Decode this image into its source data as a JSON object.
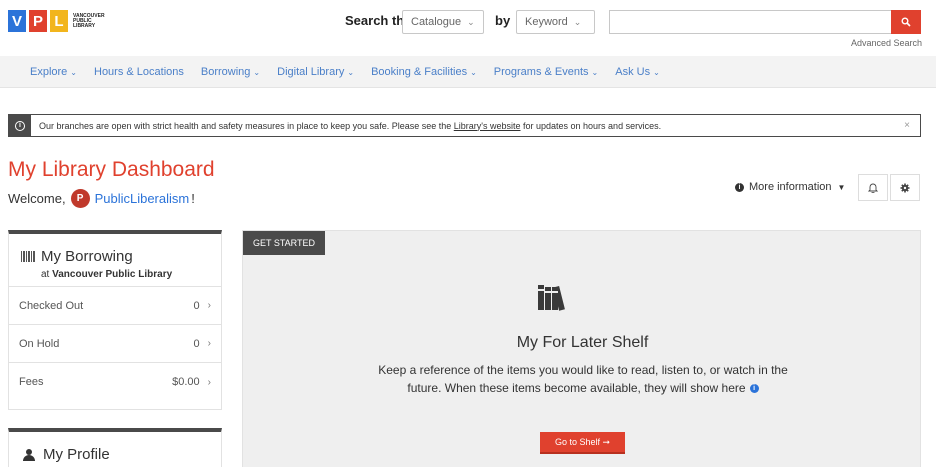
{
  "header": {
    "logo_letters": [
      "V",
      "P",
      "L"
    ],
    "logo_text": "VANCOUVER PUBLIC LIBRARY",
    "search_label": "Search the",
    "catalogue_select": "Catalogue",
    "by_label": "by",
    "keyword_select": "Keyword",
    "search_value": "",
    "advanced_search": "Advanced Search"
  },
  "nav": {
    "items": [
      {
        "label": "Explore",
        "dropdown": true
      },
      {
        "label": "Hours & Locations",
        "dropdown": false
      },
      {
        "label": "Borrowing",
        "dropdown": true
      },
      {
        "label": "Digital Library",
        "dropdown": true
      },
      {
        "label": "Booking & Facilities",
        "dropdown": true
      },
      {
        "label": "Programs & Events",
        "dropdown": true
      },
      {
        "label": "Ask Us",
        "dropdown": true
      }
    ]
  },
  "alert": {
    "text_before": "Our branches are open with strict health and safety measures in place to keep you safe.  Please see the ",
    "link": "Library's website",
    "text_after": " for updates on hours and services.",
    "close": "×"
  },
  "dashboard": {
    "title": "My Library Dashboard",
    "welcome": "Welcome,",
    "avatar_letter": "P",
    "username": "PublicLiberalism",
    "exclaim": "!",
    "more_info": "More information"
  },
  "borrowing": {
    "title": "My Borrowing",
    "at": "at",
    "library": "Vancouver Public Library",
    "rows": [
      {
        "label": "Checked Out",
        "value": "0"
      },
      {
        "label": "On Hold",
        "value": "0"
      },
      {
        "label": "Fees",
        "value": "$0.00"
      }
    ]
  },
  "profile": {
    "title": "My Profile"
  },
  "main": {
    "tag": "GET STARTED",
    "shelf_title": "My For Later Shelf",
    "shelf_desc": "Keep a reference of the items you would like to read, listen to, or watch in the future. When these items become available, they will show here",
    "button": "Go to Shelf ➞"
  },
  "colors": {
    "accent": "#e0412e",
    "link": "#2b73d9",
    "dark": "#4a4a4a"
  }
}
